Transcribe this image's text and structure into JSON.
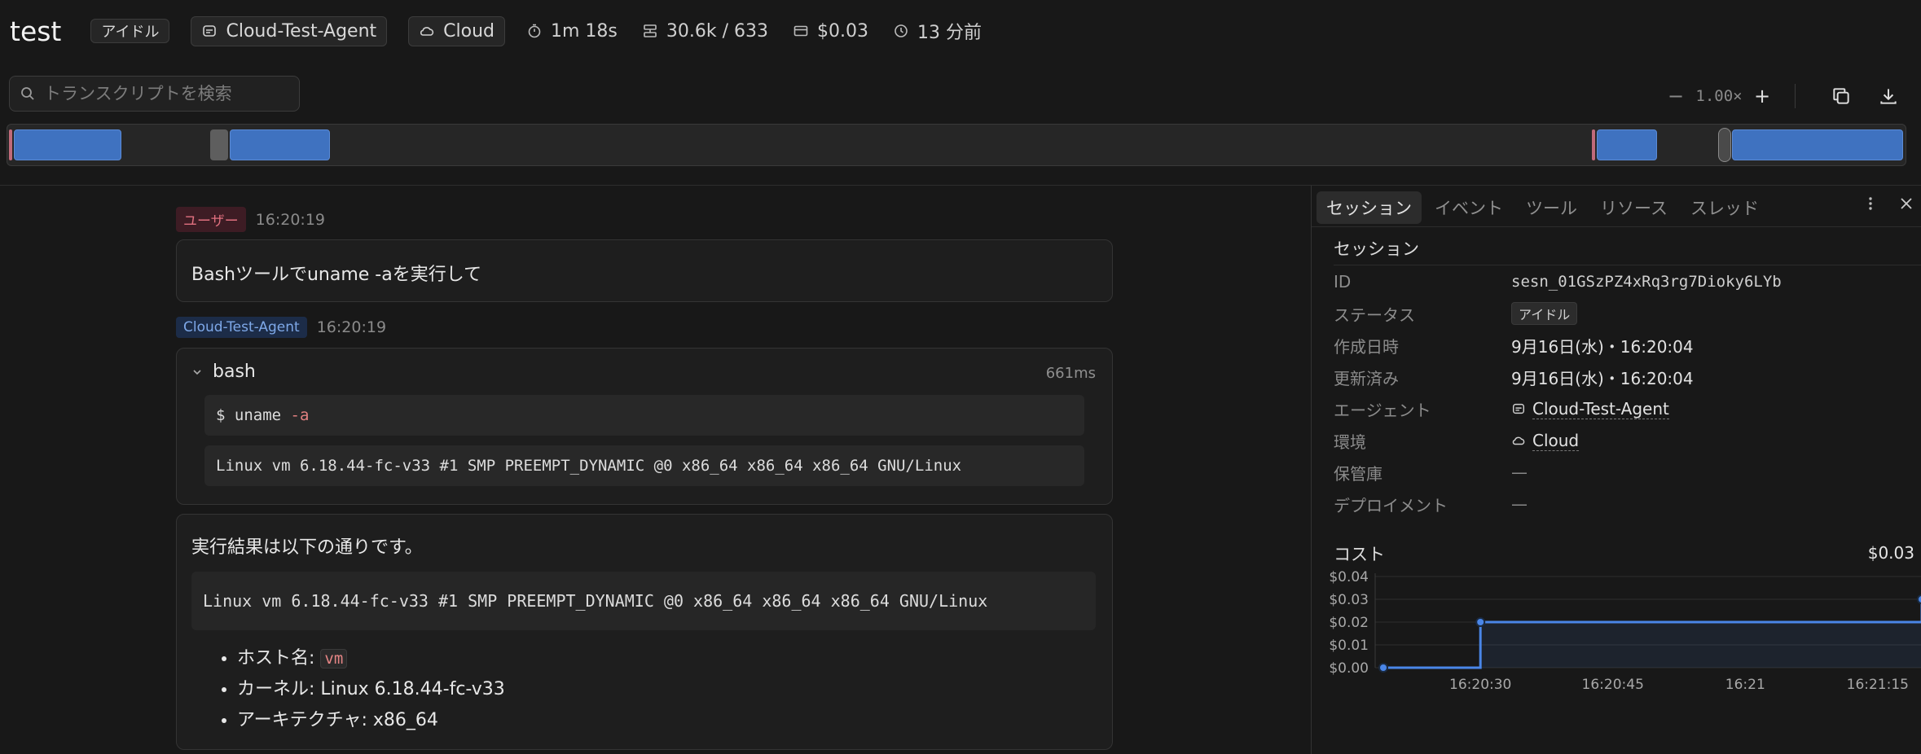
{
  "header": {
    "title": "test",
    "status": "アイドル",
    "agent": "Cloud-Test-Agent",
    "environment": "Cloud",
    "duration": "1m 18s",
    "tokens": "30.6k / 633",
    "cost": "$0.03",
    "time_ago": "13 分前"
  },
  "search": {
    "placeholder": "トランスクリプトを検索"
  },
  "zoom": {
    "minus": "−",
    "value": "1.00×",
    "plus": "+"
  },
  "timeline": {
    "blocks": [
      {
        "kind": "red"
      },
      {
        "kind": "blue"
      },
      {
        "kind": "gray"
      },
      {
        "kind": "blue"
      },
      {
        "kind": "red"
      },
      {
        "kind": "blue"
      },
      {
        "kind": "blue"
      }
    ]
  },
  "transcript": {
    "user_badge": "ユーザー",
    "user_time": "16:20:19",
    "user_message": "Bashツールでuname -aを実行して",
    "agent_badge": "Cloud-Test-Agent",
    "agent_time": "16:20:19",
    "tool": {
      "name": "bash",
      "duration": "661ms",
      "command_prefix": "$ uname ",
      "command_flag": "-a",
      "output": "Linux vm 6.18.44-fc-v33 #1 SMP PREEMPT_DYNAMIC @0 x86_64 x86_64 x86_64 GNU/Linux"
    },
    "reply": {
      "intro": "実行結果は以下の通りです。",
      "code": "Linux vm 6.18.44-fc-v33 #1 SMP PREEMPT_DYNAMIC @0 x86_64 x86_64 x86_64 GNU/Linux",
      "hostname_label": "ホスト名: ",
      "hostname_value": "vm",
      "kernel": "カーネル: Linux 6.18.44-fc-v33",
      "arch": "アーキテクチャ: x86_64"
    }
  },
  "panel": {
    "tabs": [
      "セッション",
      "イベント",
      "ツール",
      "リソース",
      "スレッド"
    ],
    "section_title": "セッション",
    "rows": {
      "id_label": "ID",
      "id_value": "sesn_01GSzPZ4xRq3rg7Dioky6LYb",
      "status_label": "ステータス",
      "status_value": "アイドル",
      "created_label": "作成日時",
      "created_value": "9月16日(水)・16:20:04",
      "updated_label": "更新済み",
      "updated_value": "9月16日(水)・16:20:04",
      "agent_label": "エージェント",
      "agent_value": "Cloud-Test-Agent",
      "env_label": "環境",
      "env_value": "Cloud",
      "vault_label": "保管庫",
      "vault_value": "—",
      "deploy_label": "デプロイメント",
      "deploy_value": "—"
    },
    "cost_title": "コスト",
    "cost_value": "$0.03"
  },
  "chart_data": {
    "type": "line",
    "step": true,
    "y_ticks": [
      "$0.04",
      "$0.03",
      "$0.02",
      "$0.01",
      "$0.00"
    ],
    "x_ticks": [
      "16:20:30",
      "16:20:45",
      "16:21",
      "16:21:15"
    ],
    "ylim": [
      0,
      0.04
    ],
    "points": [
      {
        "x": "16:20:19",
        "y": 0.0
      },
      {
        "x": "16:20:30",
        "y": 0.02
      },
      {
        "x": "16:21:20",
        "y": 0.03
      }
    ],
    "color": "#4a86e8",
    "grid": true
  }
}
